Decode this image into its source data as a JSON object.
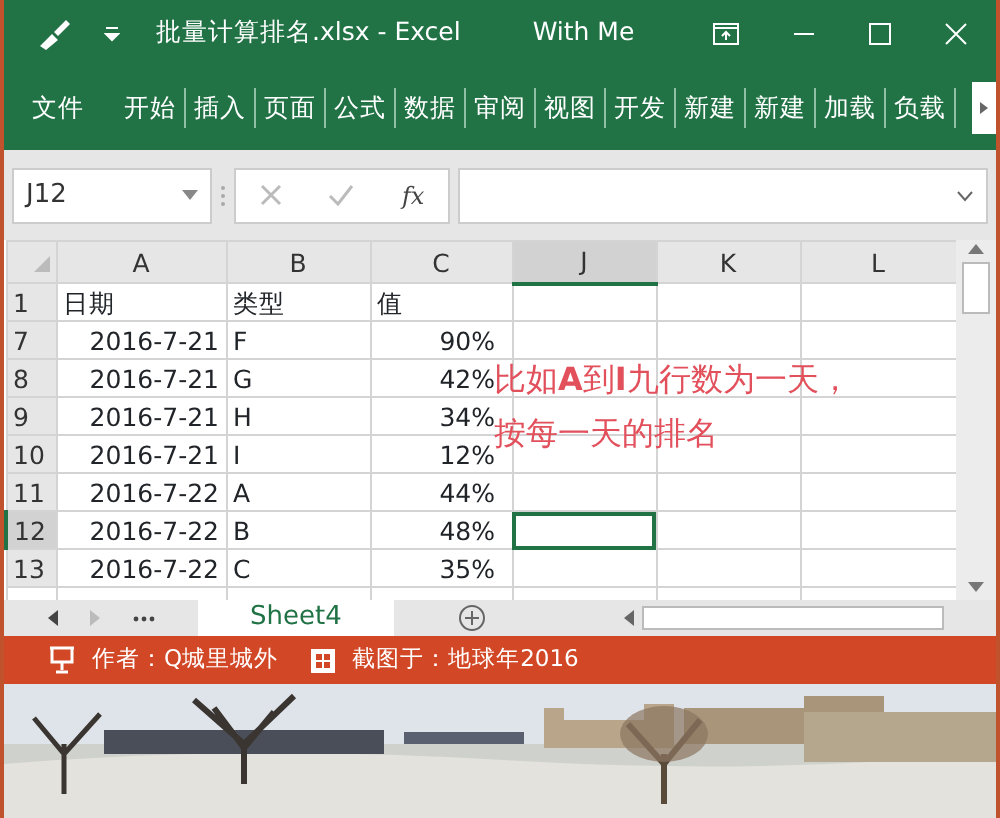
{
  "window": {
    "title": "批量计算排名.xlsx - Excel",
    "account": "With Me"
  },
  "ribbon_tabs": [
    {
      "label": "文件",
      "selected": false
    },
    {
      "label": "开始",
      "selected": false
    },
    {
      "label": "插入",
      "selected": false
    },
    {
      "label": "页面",
      "selected": false
    },
    {
      "label": "公式",
      "selected": false
    },
    {
      "label": "数据",
      "selected": false
    },
    {
      "label": "审阅",
      "selected": false
    },
    {
      "label": "视图",
      "selected": false
    },
    {
      "label": "开发",
      "selected": false
    },
    {
      "label": "新建",
      "selected": false
    },
    {
      "label": "新建",
      "selected": false
    },
    {
      "label": "加载",
      "selected": false
    },
    {
      "label": "负载",
      "selected": false
    }
  ],
  "formula_bar": {
    "name_box": "J12",
    "function_label": "fx"
  },
  "columns": [
    {
      "label": "A",
      "selected": false
    },
    {
      "label": "B",
      "selected": false
    },
    {
      "label": "C",
      "selected": false
    },
    {
      "label": "J",
      "selected": true
    },
    {
      "label": "K",
      "selected": false
    },
    {
      "label": "L",
      "selected": false
    }
  ],
  "rows": [
    {
      "number": "1",
      "selected": false,
      "cells": [
        "日期",
        "类型",
        "值"
      ]
    },
    {
      "number": "7",
      "selected": false,
      "cells": [
        "2016-7-21",
        "F",
        "90%"
      ]
    },
    {
      "number": "8",
      "selected": false,
      "cells": [
        "2016-7-21",
        "G",
        "42%"
      ]
    },
    {
      "number": "9",
      "selected": false,
      "cells": [
        "2016-7-21",
        "H",
        "34%"
      ]
    },
    {
      "number": "10",
      "selected": false,
      "cells": [
        "2016-7-21",
        "I",
        "12%"
      ]
    },
    {
      "number": "11",
      "selected": false,
      "cells": [
        "2016-7-22",
        "A",
        "44%"
      ]
    },
    {
      "number": "12",
      "selected": true,
      "cells": [
        "2016-7-22",
        "B",
        "48%"
      ]
    },
    {
      "number": "13",
      "selected": false,
      "cells": [
        "2016-7-22",
        "C",
        "35%"
      ]
    }
  ],
  "note": [
    "比如**A**到**I**九行数为一天，",
    "按每一天的排名"
  ],
  "sheet_tabs": [
    {
      "label": "Sheet4",
      "selected": true
    }
  ],
  "credit_bar": {
    "author": "作者：Q城里城外",
    "captured": "截图于：地球年2016"
  },
  "banner": {
    "kind": "picture"
  }
}
